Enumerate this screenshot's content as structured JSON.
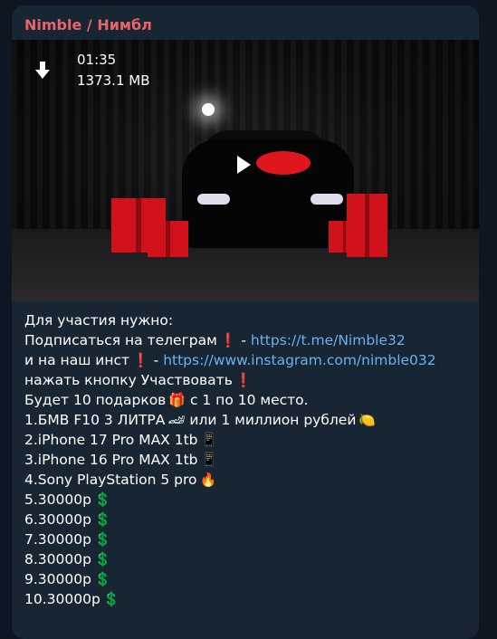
{
  "message": {
    "sender": "Nimble / Нимбл",
    "video": {
      "duration": "01:35",
      "size": "1373.1 MB"
    },
    "lines": [
      {
        "text": "Для участия нужно:"
      },
      {
        "text": "Подписаться на телеграм",
        "emoji": "❗",
        "suffix": " - ",
        "link": "https://t.me/Nimble32"
      },
      {
        "text": "и на наш инст",
        "emoji": "❗",
        "suffix": " - ",
        "link": "https://www.instagram.com/nimble032"
      },
      {
        "text": "нажать кнопку Участвовать",
        "emoji": "❗"
      },
      {
        "text": "Будет 10 подарков",
        "emoji": "🎁",
        "after": " с 1 по 10 место."
      },
      {
        "text": "1.БМВ F10 3 ЛИТРА",
        "emoji": "🏎",
        "after": " или 1 миллион рублей",
        "emoji2": "🍋"
      },
      {
        "text": "2.iPhone 17 Pro MAX 1tb",
        "emoji": "📱"
      },
      {
        "text": "3.iPhone 16 Pro MAX 1tb",
        "emoji": "📱"
      },
      {
        "text": "4.Sony PlayStation 5 pro",
        "emoji": "🔥"
      },
      {
        "text": "5.30000р",
        "emoji": "💲"
      },
      {
        "text": "6.30000р",
        "emoji": "💲"
      },
      {
        "text": "7.30000р",
        "emoji": "💲"
      },
      {
        "text": "8.30000р",
        "emoji": "💲"
      },
      {
        "text": "9.30000р",
        "emoji": "💲"
      },
      {
        "text": "10.30000р",
        "emoji": "💲"
      }
    ]
  },
  "colors": {
    "background": "#0e1621",
    "bubble": "#182533",
    "sender": "#e9646a",
    "link": "#6ab2f2",
    "text": "#ffffff"
  }
}
